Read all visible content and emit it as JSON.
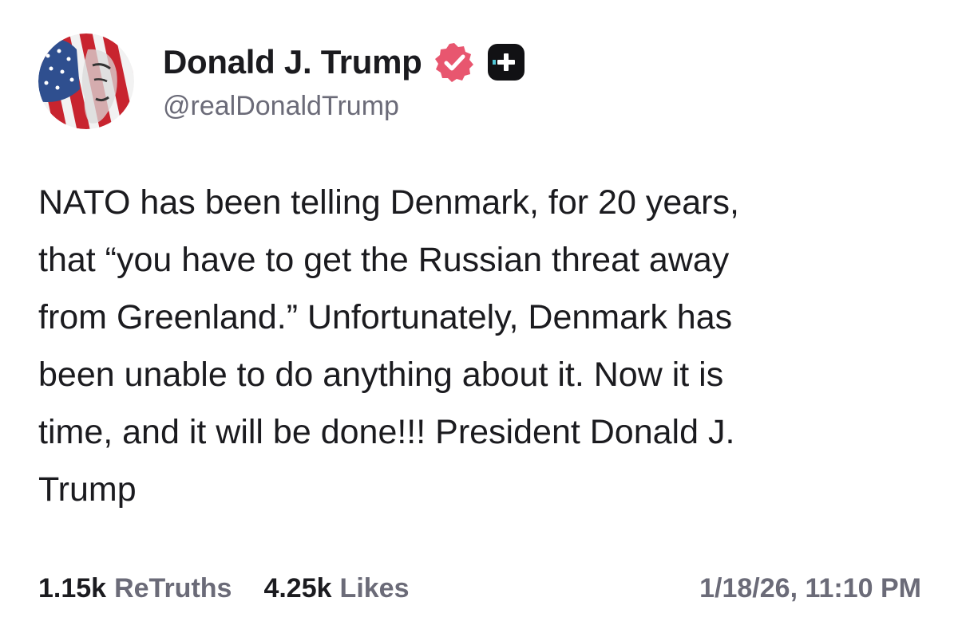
{
  "author": {
    "display_name": "Donald J. Trump",
    "handle": "@realDonaldTrump",
    "avatar_icon": "avatar-flag-portrait",
    "verified_icon": "verified-badge-icon",
    "verified_color": "#e8566f",
    "extra_icon": "plus-icon"
  },
  "post": {
    "text": "NATO has been telling Denmark, for 20 years,\nthat “you have to get the Russian threat away\nfrom Greenland.” Unfortunately, Denmark has\nbeen unable to do anything about it. Now it is\ntime, and it will be done!!! President Donald J.\nTrump"
  },
  "stats": {
    "retruths_count": "1.15k",
    "retruths_label": "ReTruths",
    "likes_count": "4.25k",
    "likes_label": "Likes",
    "timestamp": "1/18/26, 11:10 PM"
  }
}
